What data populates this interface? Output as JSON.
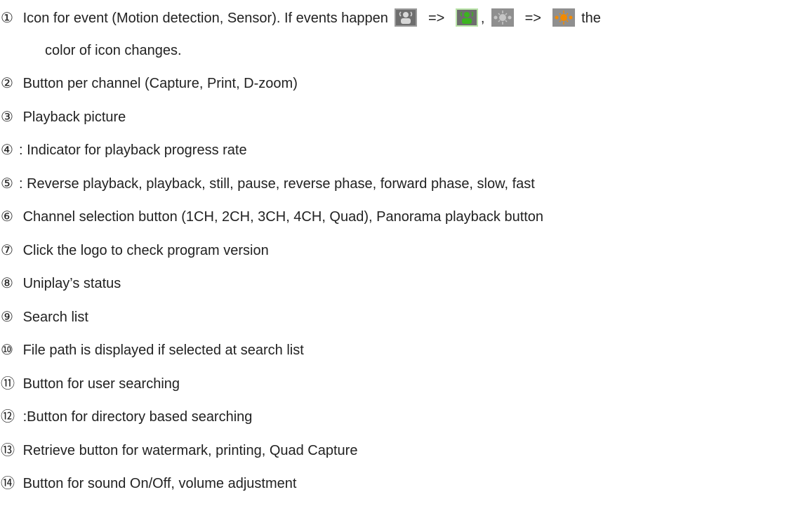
{
  "items": [
    {
      "num": "①",
      "text": "Icon for event (Motion detection, Sensor). If events happen"
    },
    {
      "num": "②",
      "text": "Button per channel (Capture, Print, D-zoom)"
    },
    {
      "num": "③",
      "text": "Playback picture"
    },
    {
      "num": "④",
      "text": ": Indicator for playback progress rate"
    },
    {
      "num": "⑤",
      "text": ": Reverse playback, playback, still, pause, reverse phase, forward phase, slow, fast"
    },
    {
      "num": "⑥",
      "text": "Channel selection button (1CH, 2CH, 3CH, 4CH, Quad), Panorama playback button"
    },
    {
      "num": "⑦",
      "text": "Click the logo to check program version"
    },
    {
      "num": "⑧",
      "text": "Uniplay’s status"
    },
    {
      "num": "⑨",
      "text": "Search list"
    },
    {
      "num": "⑩",
      "text": "File path is displayed if selected at search list"
    },
    {
      "num": "⑪",
      "text": "Button for user searching"
    },
    {
      "num": "⑫",
      "text": ":Button for directory based searching"
    },
    {
      "num": "⑬",
      "text": "Retrieve button for watermark, printing, Quad Capture"
    },
    {
      "num": "⑭",
      "text": "Button for sound On/Off, volume adjustment"
    }
  ],
  "item1_extra": {
    "arrow": "=>",
    "comma": ",",
    "tail": "the",
    "continuation": "color of icon changes."
  },
  "icons": {
    "motion_inactive": {
      "name": "motion-person-icon",
      "color": "#8a8a8a"
    },
    "motion_active": {
      "name": "motion-person-icon",
      "color": "#3bb41e"
    },
    "sensor_inactive": {
      "name": "sensor-icon",
      "color": "#8a8a8a"
    },
    "sensor_active": {
      "name": "sensor-icon",
      "color": "#f28a00"
    }
  }
}
